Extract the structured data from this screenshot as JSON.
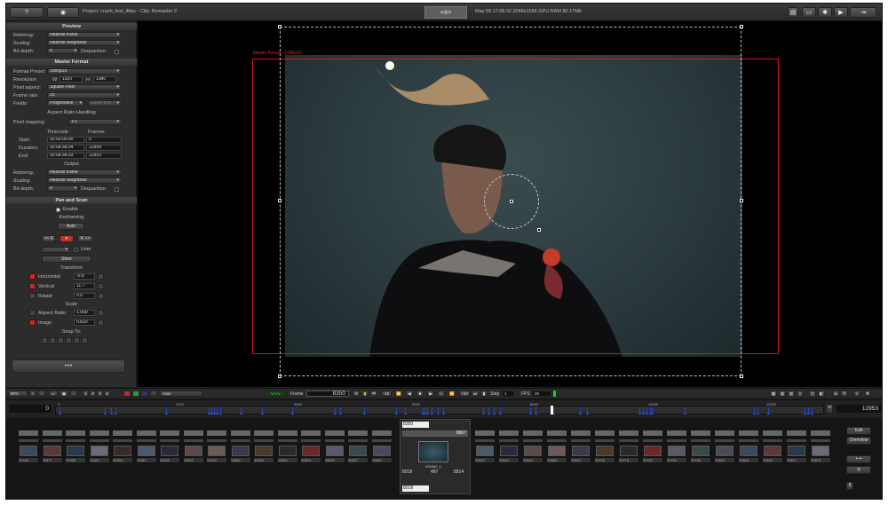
{
  "topbar": {
    "project": "Project: crash_test_iMac - Clip: Remaster 2",
    "status": "May 09 17:06:32 2048x1556 GPU RAM 80.17Mb",
    "help_icon": "?",
    "camera_icon": "camera-icon"
  },
  "preview": {
    "header": "Preview",
    "retiming_label": "Retiming:",
    "retiming_value": "Nearest frame",
    "scaling_label": "Scaling:",
    "scaling_value": "Nearest Neighbour",
    "bitdepth_label": "Bit depth:",
    "bitdepth_value": "8",
    "dequantize_label": "Dequantize:"
  },
  "master": {
    "header": "Master Format",
    "preset_label": "Format Preset:",
    "preset_value": "1080p25",
    "resolution_label": "Resolution",
    "w_label": "W",
    "w_value": "1920",
    "h_label": "H",
    "h_value": "1080",
    "aspect_label": "Pixel aspect:",
    "aspect_value": "Square Pixel",
    "rate_label": "Frame rate:",
    "rate_value": "25",
    "fields_label": "Fields:",
    "fields_value": "Progressive",
    "fields_second": "Upper first",
    "arh_header": "Aspect Ratio Handling",
    "mapping_label": "Pixel mapping:",
    "mapping_value": "1:1",
    "timecode_header": "Timecode",
    "frames_header": "Frames",
    "start_label": "Start:",
    "start_tc": "00:00:00:00",
    "start_fr": "0",
    "duration_label": "Duration:",
    "duration_tc": "00:08:38:04",
    "duration_fr": "12954",
    "end_label": "End:",
    "end_tc": "00:08:38:03",
    "end_fr": "12953",
    "output_header": "Output",
    "retiming_label": "Retiming:",
    "retiming_value": "Nearest frame",
    "scaling_label": "Scaling:",
    "scaling_value": "Nearest Neighbour",
    "bitdepth_label": "Bit depth:",
    "bitdepth_value": "8",
    "dequantize_label": "Dequantize:"
  },
  "pan": {
    "header": "Pan and Scan",
    "enable_label": "Enable",
    "keyframing": "Keyframing",
    "auto_label": "Auto",
    "prevk": "<< K",
    "nextk": "K >>",
    "user_label": "User",
    "store_label": "Store",
    "transform_header": "Transform",
    "horizontal_label": "Horizontal",
    "horizontal_value": "-0.8",
    "vertical_label": "Vertical",
    "vertical_value": "11.7",
    "rotate_label": "Rotate",
    "rotate_value": "0.0",
    "scale_header": "Scale",
    "ar_label": "Aspect Ratio",
    "ar_value": "1.000",
    "image_label": "Image",
    "image_value": "0.820",
    "snap_header": "Snap To:",
    "k": "K",
    "r": "R"
  },
  "viewer": {
    "master_frame_label": "Master format - 1080p25"
  },
  "toolbar": {
    "zoom": "80%",
    "auto_label": "Auto",
    "frame_label": "Frame",
    "frame_value": "8350",
    "step_label": "Step",
    "step_value": "1",
    "fps_label": "FPS",
    "fps_value": "25",
    "pages": [
      "1",
      "2",
      "3",
      "4"
    ]
  },
  "timeline": {
    "start": "0",
    "end": "12953",
    "ticks": [
      "0",
      "2000",
      "4000",
      "6000",
      "8000",
      "10000",
      "12000"
    ]
  },
  "thumbs": {
    "left_caps": [
      "00349",
      "00377",
      "00395",
      "00426",
      "00453",
      "00489",
      "00500",
      "00563",
      "00570",
      "00583",
      "00600",
      "00605",
      "00610",
      "00628",
      "00637",
      "00655"
    ],
    "right_caps": [
      "00647",
      "00654",
      "00664",
      "00666",
      "00691",
      "00708",
      "00718",
      "00762",
      "00764",
      "00786",
      "00800",
      "00806",
      "00835",
      "00871",
      "00873"
    ],
    "center_top": "8350",
    "center_mid": "8867",
    "center_cap": "000082_1",
    "center_bl": "8018",
    "center_bc": "497",
    "center_br": "8514",
    "center_bottom": "8018",
    "edit_label": "Edit",
    "overview_label": "Overview"
  }
}
